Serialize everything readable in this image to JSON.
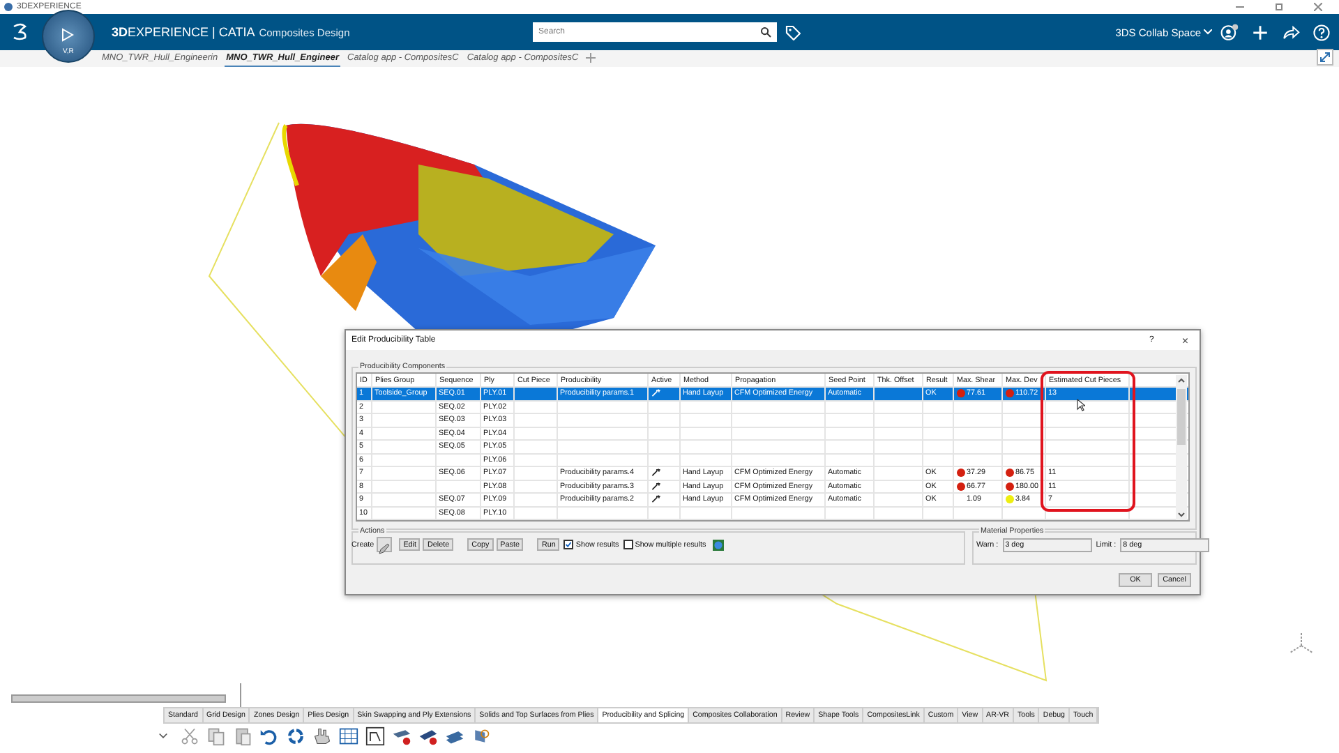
{
  "window": {
    "title": "3DEXPERIENCE"
  },
  "header": {
    "brand_bold": "3D",
    "brand_rest": "EXPERIENCE | CATIA",
    "app": "Composites Design",
    "search": {
      "placeholder": "Search"
    },
    "collab_space": "3DS Collab Space",
    "compass_label": "V,R"
  },
  "doc_tabs": [
    {
      "label": "MNO_TWR_Hull_Engineerin",
      "selected": false
    },
    {
      "label": "MNO_TWR_Hull_Engineer",
      "selected": true
    },
    {
      "label": "Catalog app - CompositesC",
      "selected": false
    },
    {
      "label": "Catalog app - CompositesC",
      "selected": false
    }
  ],
  "dialog": {
    "title": "Edit Producibility Table",
    "help": "?",
    "close": "×",
    "group_title": "Producibility Components",
    "columns": [
      "ID",
      "Plies Group",
      "Sequence",
      "Ply",
      "Cut Piece",
      "Producibility",
      "Active",
      "Method",
      "Propagation",
      "Seed Point",
      "Thk. Offset",
      "Result",
      "Max. Shear",
      "Max. Dev",
      "Estimated Cut Pieces"
    ],
    "rows": [
      {
        "id": "1",
        "plies_group": "Toolside_Group",
        "sequence": "SEQ.01",
        "ply": "PLY.01",
        "producibility": "Producibility params.1",
        "active": true,
        "method": "Hand Layup",
        "propagation": "CFM Optimized Energy",
        "seed_point": "Automatic",
        "result": "OK",
        "max_shear": {
          "value": "77.61",
          "color": "#d42010"
        },
        "max_dev": {
          "value": "110.72",
          "color": "#d42010"
        },
        "cut_pieces": "13",
        "selected": true
      },
      {
        "id": "2",
        "sequence": "SEQ.02",
        "ply": "PLY.02",
        "active": false,
        "selected": false
      },
      {
        "id": "3",
        "sequence": "SEQ.03",
        "ply": "PLY.03",
        "active": false,
        "selected": false
      },
      {
        "id": "4",
        "sequence": "SEQ.04",
        "ply": "PLY.04",
        "active": false,
        "selected": false
      },
      {
        "id": "5",
        "sequence": "SEQ.05",
        "ply": "PLY.05",
        "active": false,
        "selected": false
      },
      {
        "id": "6",
        "ply": "PLY.06",
        "active": false,
        "selected": false
      },
      {
        "id": "7",
        "sequence": "SEQ.06",
        "ply": "PLY.07",
        "producibility": "Producibility params.4",
        "active": true,
        "method": "Hand Layup",
        "propagation": "CFM Optimized Energy",
        "seed_point": "Automatic",
        "result": "OK",
        "max_shear": {
          "value": "37.29",
          "color": "#d42010"
        },
        "max_dev": {
          "value": "86.75",
          "color": "#d42010"
        },
        "cut_pieces": "11",
        "selected": false
      },
      {
        "id": "8",
        "ply": "PLY.08",
        "producibility": "Producibility params.3",
        "active": true,
        "method": "Hand Layup",
        "propagation": "CFM Optimized Energy",
        "seed_point": "Automatic",
        "result": "OK",
        "max_shear": {
          "value": "66.77",
          "color": "#d42010"
        },
        "max_dev": {
          "value": "180.00",
          "color": "#d42010"
        },
        "cut_pieces": "11",
        "selected": false
      },
      {
        "id": "9",
        "sequence": "SEQ.07",
        "ply": "PLY.09",
        "producibility": "Producibility params.2",
        "active": true,
        "method": "Hand Layup",
        "propagation": "CFM Optimized Energy",
        "seed_point": "Automatic",
        "result": "OK",
        "max_shear": {
          "value": "1.09"
        },
        "max_dev": {
          "value": "3.84",
          "color": "#eeee10"
        },
        "cut_pieces": "7",
        "selected": false
      },
      {
        "id": "10",
        "sequence": "SEQ.08",
        "ply": "PLY.10",
        "active": false,
        "selected": false
      }
    ],
    "actions": {
      "title": "Actions",
      "create": "Create",
      "buttons": [
        "Edit",
        "Delete",
        "Copy",
        "Paste",
        "Run"
      ],
      "show_results": {
        "label": "Show results",
        "checked": true
      },
      "show_multiple": {
        "label": "Show multiple results",
        "checked": false
      }
    },
    "material": {
      "title": "Material Properties",
      "warn_label": "Warn :",
      "warn": "3 deg",
      "limit_label": "Limit :",
      "limit": "8 deg"
    },
    "footer_buttons": [
      "OK",
      "Cancel"
    ]
  },
  "toolbar_tabs": [
    {
      "label": "Standard",
      "selected": false
    },
    {
      "label": "Grid Design",
      "selected": false
    },
    {
      "label": "Zones Design",
      "selected": false
    },
    {
      "label": "Plies Design",
      "selected": false
    },
    {
      "label": "Skin Swapping and Ply Extensions",
      "selected": false
    },
    {
      "label": "Solids and Top Surfaces from Plies",
      "selected": false
    },
    {
      "label": "Producibility and Splicing",
      "selected": true
    },
    {
      "label": "Composites Collaboration",
      "selected": false
    },
    {
      "label": "Review",
      "selected": false
    },
    {
      "label": "Shape Tools",
      "selected": false
    },
    {
      "label": "CompositesLink",
      "selected": false
    },
    {
      "label": "Custom",
      "selected": false
    },
    {
      "label": "View",
      "selected": false
    },
    {
      "label": "AR-VR",
      "selected": false
    },
    {
      "label": "Tools",
      "selected": false
    },
    {
      "label": "Debug",
      "selected": false
    },
    {
      "label": "Touch",
      "selected": false
    }
  ]
}
